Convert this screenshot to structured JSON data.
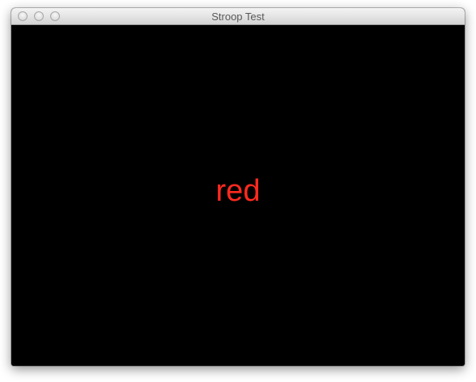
{
  "window": {
    "title": "Stroop Test"
  },
  "stimulus": {
    "word": "red",
    "ink_color": "#ff2a1f"
  },
  "colors": {
    "background": "#000000"
  }
}
